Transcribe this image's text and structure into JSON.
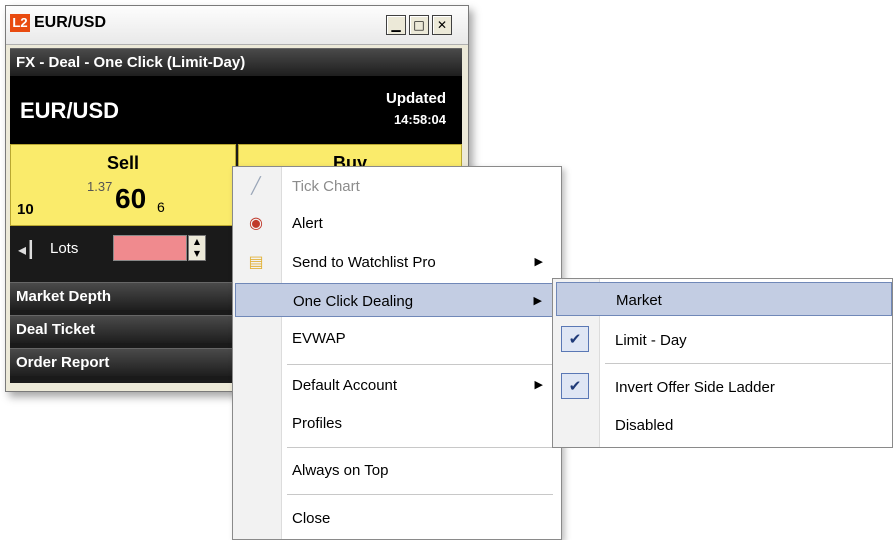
{
  "window": {
    "logo": "L2",
    "title": "EUR/USD",
    "controls": [
      "minimize",
      "maximize",
      "close"
    ]
  },
  "ticket": {
    "header_bar": "FX - Deal - One Click (Limit-Day)",
    "pair": "EUR/USD",
    "updated_label": "Updated",
    "updated_time": "14:58:04",
    "sell": {
      "label": "Sell",
      "quantity": "10",
      "price_prefix": "1.37",
      "price_big": "60",
      "price_pip": "6"
    },
    "buy": {
      "label": "Buy"
    },
    "lots_label": "Lots",
    "sections": [
      "Market Depth",
      "Deal Ticket",
      "Order Report"
    ]
  },
  "context_menu": {
    "items": [
      {
        "label": "Tick Chart",
        "icon": "chart-icon",
        "disabled": true
      },
      {
        "label": "Alert",
        "icon": "alert-icon"
      },
      {
        "label": "Send to Watchlist Pro",
        "icon": "watchlist-icon",
        "submenu": true
      },
      {
        "label": "One Click Dealing",
        "submenu": true,
        "highlighted": true
      },
      {
        "label": "EVWAP"
      },
      {
        "label": "Default Account",
        "submenu": true
      },
      {
        "label": "Profiles"
      },
      {
        "label": "Always on Top"
      },
      {
        "label": "Close"
      }
    ]
  },
  "submenu": {
    "items": [
      {
        "label": "Market",
        "highlighted": true
      },
      {
        "label": "Limit - Day",
        "checked": true
      },
      {
        "label": "Invert Offer Side Ladder",
        "checked": true
      },
      {
        "label": "Disabled"
      }
    ]
  },
  "colors": {
    "price_panel": "#faeb6b",
    "lots_input": "#f08a8e",
    "menu_highlight": "#c3cde3",
    "logo": "#e94b10"
  }
}
